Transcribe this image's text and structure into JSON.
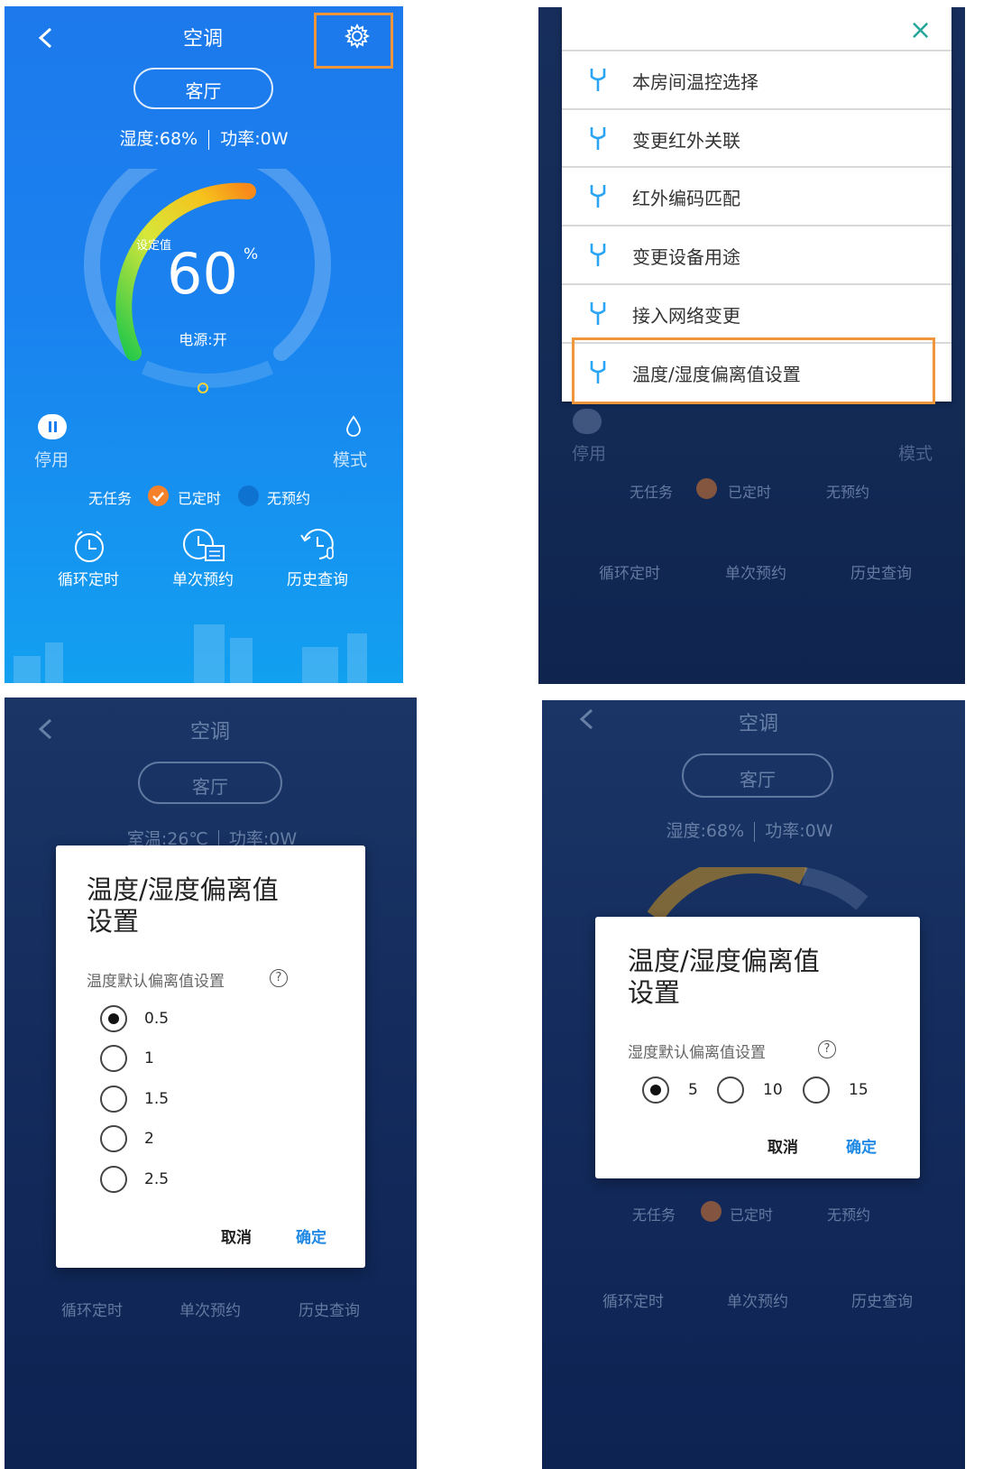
{
  "screen": {
    "back_glyph": "<",
    "title": "空调",
    "room": "客厅",
    "status_humidity": "湿度:68%",
    "status_power": "功率:0W",
    "status_temp": "室温:26℃",
    "setpoint_label": "设定值",
    "setpoint_value": "60",
    "setpoint_unit": "%",
    "power_state": "电源:开",
    "pause_label": "停用",
    "mode_label": "模式",
    "tasks": {
      "none": "无任务",
      "timed": "已定时",
      "no_booking": "无预约"
    },
    "bottom_buttons": [
      {
        "label": "循环定时",
        "icon": "alarm-clock-icon"
      },
      {
        "label": "单次预约",
        "icon": "clock-booking-icon"
      },
      {
        "label": "历史查询",
        "icon": "history-thermometer-icon"
      }
    ],
    "dial_level_fraction": 0.6
  },
  "settings_menu": {
    "close_glyph": "×",
    "items": [
      {
        "label": "本房间温控选择",
        "icon": "wrench-icon"
      },
      {
        "label": "变更红外关联",
        "icon": "wrench-icon"
      },
      {
        "label": "红外编码匹配",
        "icon": "wrench-icon"
      },
      {
        "label": "变更设备用途",
        "icon": "wrench-icon"
      },
      {
        "label": "接入网络变更",
        "icon": "wrench-icon"
      },
      {
        "label": "温度/湿度偏离值设置",
        "icon": "wrench-icon"
      }
    ]
  },
  "temp_dialog": {
    "title_line1": "温度/湿度偏离值",
    "title_line2": "设置",
    "subtitle": "温度默认偏离值设置",
    "help_glyph": "?",
    "options": [
      "0.5",
      "1",
      "1.5",
      "2",
      "2.5"
    ],
    "selected": "0.5",
    "cancel": "取消",
    "confirm": "确定"
  },
  "humidity_dialog": {
    "title_line1": "温度/湿度偏离值",
    "title_line2": "设置",
    "subtitle": "湿度默认偏离值设置",
    "help_glyph": "?",
    "options": [
      "5",
      "10",
      "15"
    ],
    "selected": "5",
    "cancel": "取消",
    "confirm": "确定"
  },
  "colors": {
    "highlight": "#f0953a",
    "accent_blue": "#1e88e5",
    "checked_orange": "#f5822a"
  }
}
